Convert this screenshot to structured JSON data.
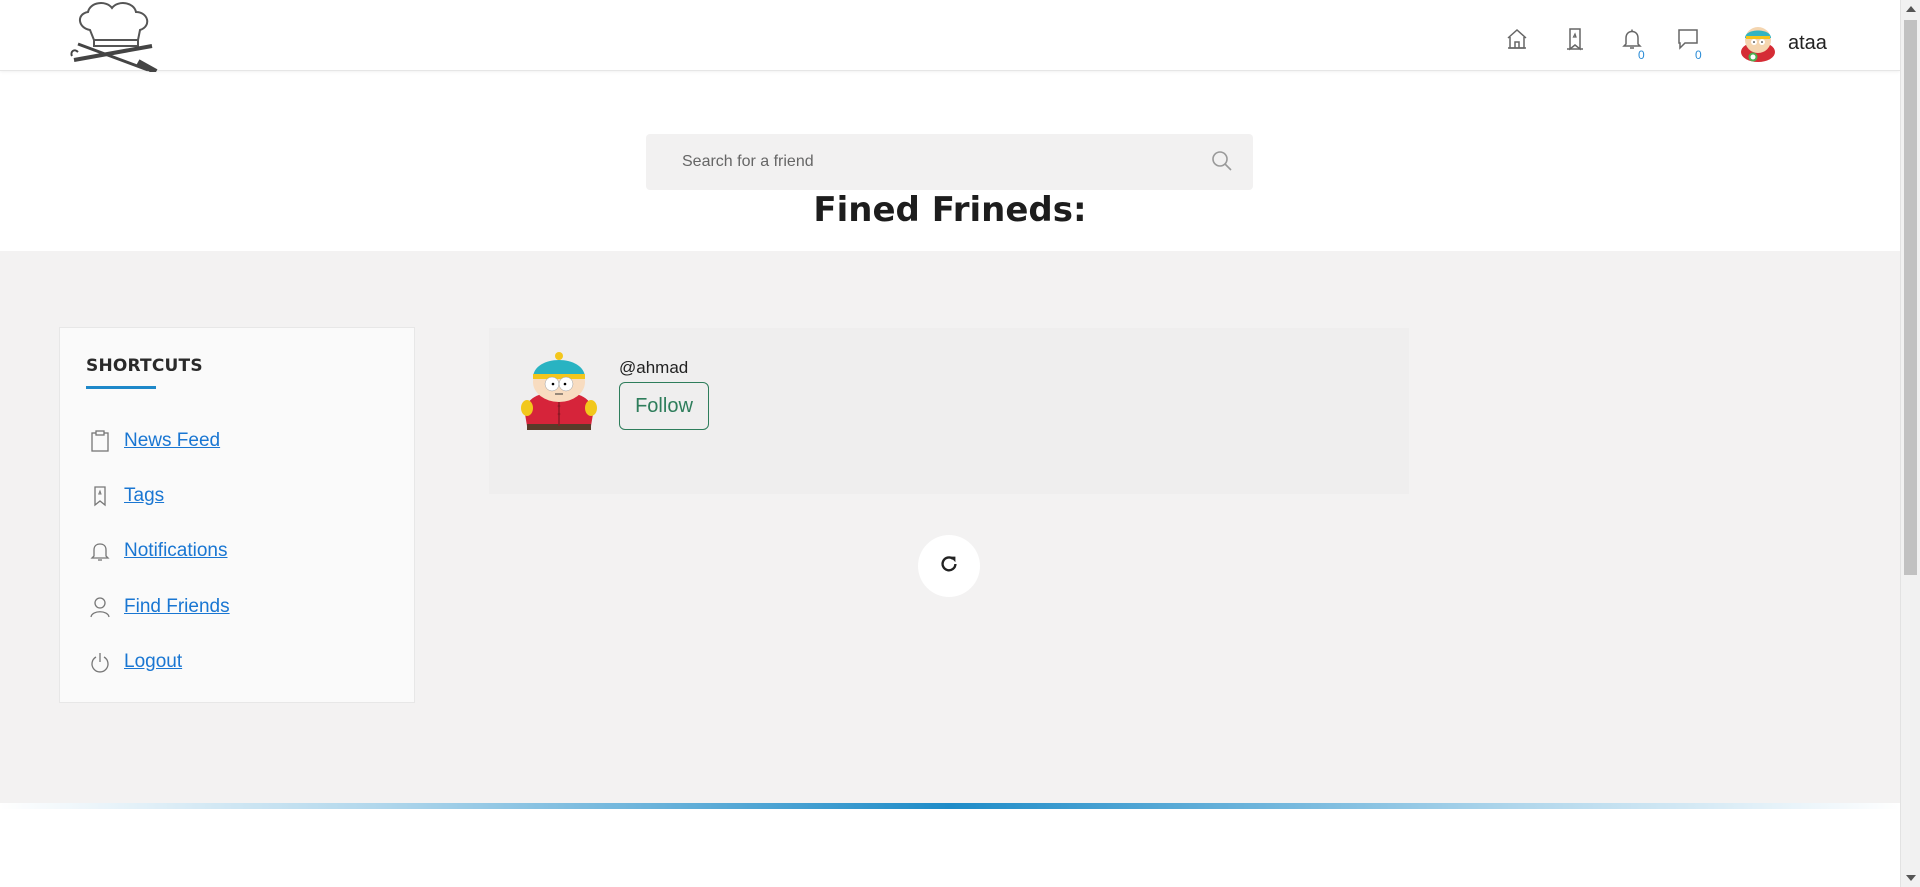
{
  "header": {
    "username": "ataa",
    "notification_count": "0",
    "message_count": "0",
    "icons": [
      "home-icon",
      "tag-icon",
      "bell-icon",
      "chat-icon"
    ]
  },
  "search": {
    "placeholder": "Search for a friend",
    "value": ""
  },
  "page": {
    "title": "Fined Frineds:"
  },
  "shortcuts": {
    "title": "SHORTCUTS",
    "items": [
      {
        "label": "News Feed",
        "icon": "clipboard-icon"
      },
      {
        "label": "Tags",
        "icon": "tag-icon"
      },
      {
        "label": "Notifications",
        "icon": "bell-icon"
      },
      {
        "label": "Find Friends",
        "icon": "user-icon"
      },
      {
        "label": "Logout",
        "icon": "power-icon"
      }
    ]
  },
  "results": [
    {
      "handle": "@ahmad",
      "action": "Follow"
    }
  ],
  "colors": {
    "accent": "#1e88c9",
    "link": "#1976d2",
    "follow": "#2e7d5b",
    "main_bg": "#f3f2f2"
  }
}
